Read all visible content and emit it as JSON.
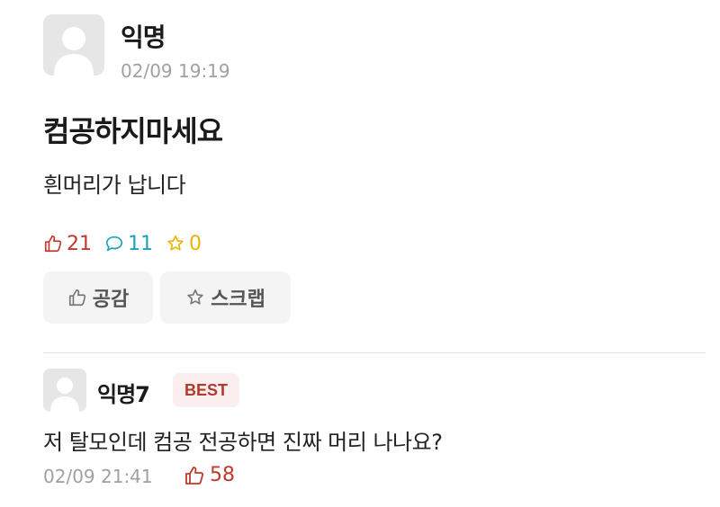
{
  "post": {
    "author": "익명",
    "timestamp": "02/09 19:19",
    "title": "컴공하지마세요",
    "body": "흰머리가 납니다",
    "stats": {
      "likes": "21",
      "comments": "11",
      "scraps": "0"
    },
    "buttons": {
      "like_label": "공감",
      "scrap_label": "스크랩"
    }
  },
  "comment": {
    "author": "익명7",
    "badge": "BEST",
    "text": "저 탈모인데 컴공 전공하면 진짜 머리 나나요?",
    "timestamp": "02/09 21:41",
    "likes": "58"
  },
  "colors": {
    "like": "#c0392b",
    "comment": "#1aa3b8",
    "scrap": "#e8b400",
    "badge_bg": "#fbeeee",
    "badge_text": "#b03a2e"
  },
  "icons": [
    "avatar-placeholder-icon",
    "thumbs-up-icon",
    "speech-bubble-icon",
    "star-icon"
  ]
}
